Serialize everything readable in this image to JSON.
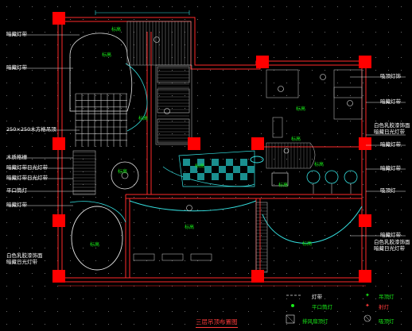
{
  "title": "三层吊顶布置图",
  "labels_left": [
    "暗藏灯带",
    "暗藏灯带",
    "250×250木方格吊顶",
    "木质格栅",
    "暗藏灯带日光灯带",
    "暗藏灯带日光灯带",
    "平口筒灯",
    "暗藏灯带",
    "白色乳胶漆饰面",
    "暗藏日光灯带"
  ],
  "labels_right": [
    "吸顶灯饰",
    "暗藏灯带",
    "白色乳胶漆饰面",
    "暗藏日光灯带",
    "暗藏灯带",
    "暗藏灯带",
    "吸顶灯",
    "暗藏灯带",
    "白色乳胶漆饰面",
    "暗藏日光灯带"
  ],
  "room_tag": "标高",
  "legend": {
    "items": [
      {
        "label": "灯带",
        "color": "#ffffff"
      },
      {
        "label": "平口筒灯",
        "color": "#18e818"
      },
      {
        "label": "吊顶灯",
        "color": "#ff3a3a"
      },
      {
        "label": "射灯",
        "color": "#18e818"
      },
      {
        "label": "排风扇顶灯",
        "color": "#18e818"
      },
      {
        "label": "吸顶灯",
        "color": "#18e818"
      }
    ]
  },
  "colors": {
    "wall": "#ff2a2a",
    "cyan": "#35e0e0",
    "green": "#18e818",
    "white": "#e6e6e6",
    "column": "#ff0000",
    "bg": "#000000"
  }
}
